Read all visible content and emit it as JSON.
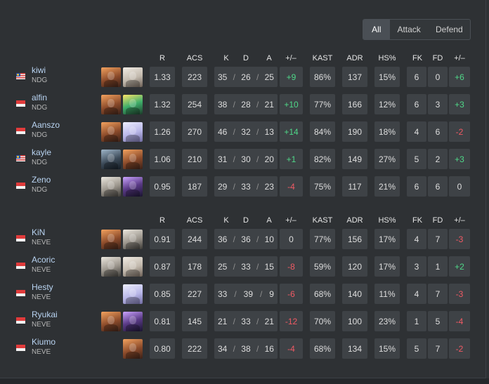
{
  "tabs": [
    {
      "label": "All",
      "active": true
    },
    {
      "label": "Attack",
      "active": false
    },
    {
      "label": "Defend",
      "active": false
    }
  ],
  "columns": [
    "R",
    "ACS",
    "K",
    "D",
    "A",
    "+/–",
    "KAST",
    "ADR",
    "HS%",
    "FK",
    "FD",
    "+/–"
  ],
  "kda_separator": "/",
  "teams": [
    {
      "players": [
        {
          "name": "kiwi",
          "team": "NDG",
          "flag": "MY",
          "agents": [
            "orange",
            "white"
          ],
          "r": "1.33",
          "acs": "223",
          "k": "35",
          "d": "26",
          "a": "25",
          "pm": "+9",
          "kast": "86%",
          "adr": "137",
          "hs": "15%",
          "fk": "6",
          "fd": "0",
          "fpm": "+6"
        },
        {
          "name": "alfin",
          "team": "NDG",
          "flag": "SG",
          "agents": [
            "orange",
            "green"
          ],
          "r": "1.32",
          "acs": "254",
          "k": "38",
          "d": "28",
          "a": "21",
          "pm": "+10",
          "kast": "77%",
          "adr": "166",
          "hs": "12%",
          "fk": "6",
          "fd": "3",
          "fpm": "+3"
        },
        {
          "name": "Aanszo",
          "team": "NDG",
          "flag": "SG",
          "agents": [
            "orange",
            "lavender"
          ],
          "r": "1.26",
          "acs": "270",
          "k": "46",
          "d": "32",
          "a": "13",
          "pm": "+14",
          "kast": "84%",
          "adr": "190",
          "hs": "18%",
          "fk": "4",
          "fd": "6",
          "fpm": "-2"
        },
        {
          "name": "kayle",
          "team": "NDG",
          "flag": "MY",
          "agents": [
            "dark",
            "orange"
          ],
          "r": "1.06",
          "acs": "210",
          "k": "31",
          "d": "30",
          "a": "20",
          "pm": "+1",
          "kast": "82%",
          "adr": "149",
          "hs": "27%",
          "fk": "5",
          "fd": "2",
          "fpm": "+3"
        },
        {
          "name": "Zeno",
          "team": "NDG",
          "flag": "SG",
          "agents": [
            "cypher",
            "purple"
          ],
          "r": "0.95",
          "acs": "187",
          "k": "29",
          "d": "33",
          "a": "23",
          "pm": "-4",
          "kast": "75%",
          "adr": "117",
          "hs": "21%",
          "fk": "6",
          "fd": "6",
          "fpm": "0"
        }
      ]
    },
    {
      "players": [
        {
          "name": "KiN",
          "team": "NEVE",
          "flag": "SG",
          "agents": [
            "orange",
            "cypher"
          ],
          "r": "0.91",
          "acs": "244",
          "k": "36",
          "d": "36",
          "a": "10",
          "pm": "0",
          "kast": "77%",
          "adr": "156",
          "hs": "17%",
          "fk": "4",
          "fd": "7",
          "fpm": "-3"
        },
        {
          "name": "Acoric",
          "team": "NEVE",
          "flag": "SG",
          "agents": [
            "cypher",
            "white"
          ],
          "r": "0.87",
          "acs": "178",
          "k": "25",
          "d": "33",
          "a": "15",
          "pm": "-8",
          "kast": "59%",
          "adr": "120",
          "hs": "17%",
          "fk": "3",
          "fd": "1",
          "fpm": "+2"
        },
        {
          "name": "Hesty",
          "team": "NEVE",
          "flag": "SG",
          "agents": [
            "lavender"
          ],
          "r": "0.85",
          "acs": "227",
          "k": "33",
          "d": "39",
          "a": "9",
          "pm": "-6",
          "kast": "68%",
          "adr": "140",
          "hs": "11%",
          "fk": "4",
          "fd": "7",
          "fpm": "-3"
        },
        {
          "name": "Ryukai",
          "team": "NEVE",
          "flag": "SG",
          "agents": [
            "orange",
            "purple"
          ],
          "r": "0.81",
          "acs": "145",
          "k": "21",
          "d": "33",
          "a": "21",
          "pm": "-12",
          "kast": "70%",
          "adr": "100",
          "hs": "23%",
          "fk": "1",
          "fd": "5",
          "fpm": "-4"
        },
        {
          "name": "Kiumo",
          "team": "NEVE",
          "flag": "SG",
          "agents": [
            "orange"
          ],
          "r": "0.80",
          "acs": "222",
          "k": "34",
          "d": "38",
          "a": "16",
          "pm": "-4",
          "kast": "68%",
          "adr": "134",
          "hs": "15%",
          "fk": "5",
          "fd": "7",
          "fpm": "-2"
        }
      ]
    }
  ],
  "colors": {
    "positive": "#4fd888",
    "negative": "#f05a64",
    "player_name": "#b9d4f2",
    "cell_bg": "#3e4246"
  }
}
